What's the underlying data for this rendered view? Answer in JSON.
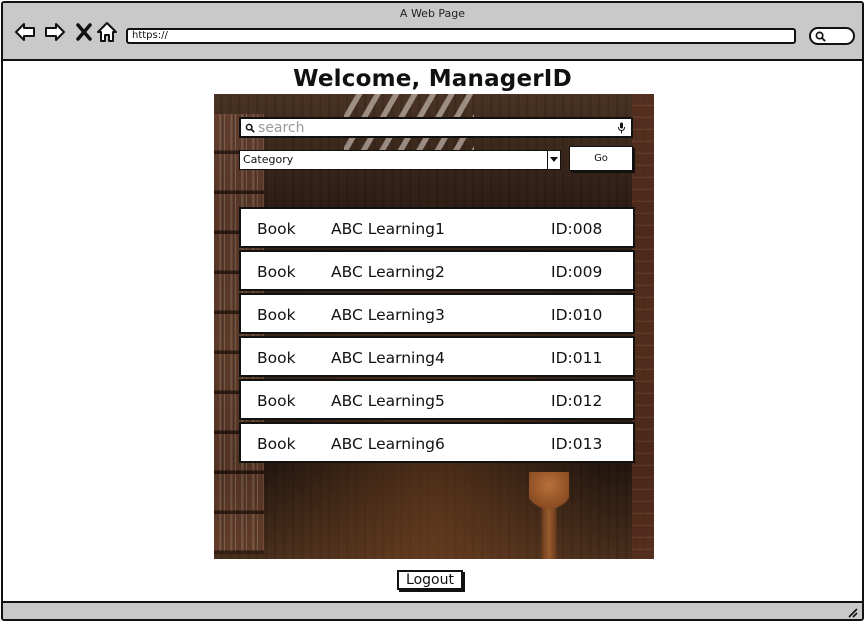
{
  "window": {
    "title": "A Web Page",
    "url": "https://"
  },
  "page": {
    "title": "Welcome, ManagerID"
  },
  "search": {
    "placeholder": "search",
    "value": ""
  },
  "filter": {
    "category": "Category",
    "go_label": "Go"
  },
  "results": [
    {
      "type": "Book",
      "title": "ABC Learning1",
      "id": "ID:008"
    },
    {
      "type": "Book",
      "title": "ABC Learning2",
      "id": "ID:009"
    },
    {
      "type": "Book",
      "title": "ABC Learning3",
      "id": "ID:010"
    },
    {
      "type": "Book",
      "title": "ABC Learning4",
      "id": "ID:011"
    },
    {
      "type": "Book",
      "title": "ABC Learning5",
      "id": "ID:012"
    },
    {
      "type": "Book",
      "title": "ABC Learning6",
      "id": "ID:013"
    }
  ],
  "footer": {
    "logout_label": "Logout"
  },
  "icons": {
    "back": "arrow-left-icon",
    "forward": "arrow-right-icon",
    "stop": "close-icon",
    "home": "home-icon",
    "search": "search-icon",
    "mic": "microphone-icon",
    "dropdown": "chevron-down-icon",
    "resize": "resize-grip-icon"
  },
  "colors": {
    "chrome": "#c9c9c9",
    "border": "#111111",
    "panel_background": "#3b2718"
  }
}
